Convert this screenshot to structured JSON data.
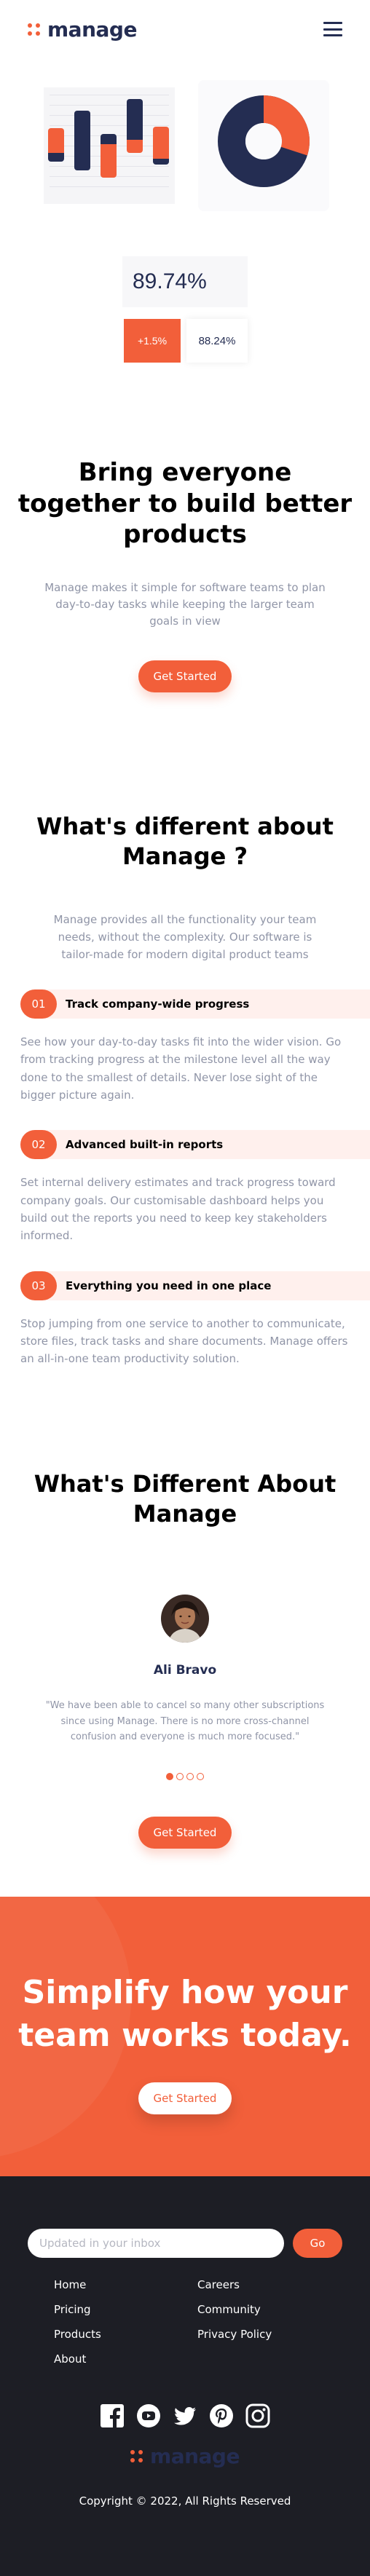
{
  "header": {
    "logo_text": "manage",
    "menu_icon": "hamburger-icon"
  },
  "hero_illustration": {
    "percentage": "89.74%",
    "change": "+1.5%",
    "value": "88.24%",
    "donut_fraction": 0.3
  },
  "hero": {
    "title": "Bring everyone together to build better products",
    "text": "Manage makes it simple for software teams to plan day-to-day tasks while keeping the larger team goals in view",
    "button": "Get Started"
  },
  "features": {
    "title": "What's different about Manage ?",
    "text": "Manage provides all the functionality your team needs, without the complexity. Our software is tailor-made for modern digital product teams",
    "items": [
      {
        "number": "01",
        "title": "Track company-wide progress",
        "text": "See how your day-to-day tasks fit into the wider vision. Go from tracking progress at the milestone level all the way done to the smallest of details. Never lose sight of the bigger picture again."
      },
      {
        "number": "02",
        "title": "Advanced built-in reports",
        "text": "Set internal delivery estimates and track progress toward company goals. Our customisable dashboard helps you build out the reports you need to keep key stakeholders informed."
      },
      {
        "number": "03",
        "title": "Everything you need in one place",
        "text": "Stop jumping from one service to another to communicate, store files, track tasks and share documents. Manage offers an all-in-one team productivity solution."
      }
    ]
  },
  "testimonials": {
    "title": "What's Different About Manage",
    "name": "Ali Bravo",
    "quote": "\"We have been able to cancel so many other subscriptions since using Manage. There is no more cross-channel confusion and everyone is much more focused.\"",
    "active_index": 0,
    "button": "Get Started"
  },
  "cta": {
    "title": "Simplify how your team works today.",
    "button": "Get Started"
  },
  "footer": {
    "newsletter_placeholder": "Updated in your inbox",
    "newsletter_button": "Go",
    "links_left": [
      "Home",
      "Pricing",
      "Products",
      "About"
    ],
    "links_right": [
      "Careers",
      "Community",
      "Privacy Policy"
    ],
    "social_icons": [
      "facebook-icon",
      "youtube-icon",
      "twitter-icon",
      "pinterest-icon",
      "instagram-icon"
    ],
    "logo_text": "manage",
    "copyright": "Copyright © 2022, All Rights Reserved"
  },
  "colors": {
    "accent": "#f25f3a",
    "navy": "#242d52",
    "footer_bg": "#1d1e25"
  }
}
